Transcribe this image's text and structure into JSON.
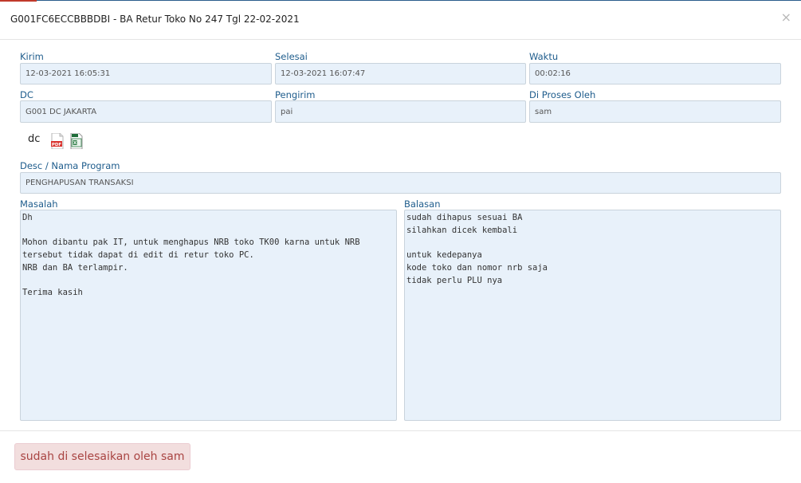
{
  "modal": {
    "title": "G001FC6ECCBBBDBI - BA Retur Toko No 247 Tgl 22-02-2021",
    "close_icon": "close-x"
  },
  "fields": {
    "kirim": {
      "label": "Kirim",
      "value": "12-03-2021 16:05:31"
    },
    "selesai": {
      "label": "Selesai",
      "value": "12-03-2021 16:07:47"
    },
    "waktu": {
      "label": "Waktu",
      "value": "00:02:16"
    },
    "dc": {
      "label": "DC",
      "value": "G001 DC JAKARTA"
    },
    "pengirim": {
      "label": "Pengirim",
      "value": "pai"
    },
    "diproses": {
      "label": "Di Proses Oleh",
      "value": "sam"
    },
    "desc": {
      "label": "Desc / Nama Program",
      "value": "PENGHAPUSAN TRANSAKSI"
    }
  },
  "attachments": {
    "prefix": "dc",
    "icons": [
      "pdf-file-icon",
      "excel-file-icon"
    ]
  },
  "masalah": {
    "label": "Masalah",
    "text": "Dh\n\nMohon dibantu pak IT, untuk menghapus NRB toko TK00 karna untuk NRB\ntersebut tidak dapat di edit di retur toko PC.\nNRB dan BA terlampir.\n\nTerima kasih"
  },
  "balasan": {
    "label": "Balasan",
    "text": "sudah dihapus sesuai BA\nsilahkan dicek kembali\n\nuntuk kedepanya\nkode toko dan nomor nrb saja\ntidak perlu PLU nya"
  },
  "footer": {
    "status_button": "sudah di selesaikan oleh sam"
  },
  "colors": {
    "label": "#1e5c8c",
    "field_bg": "#e8f1fa",
    "danger_bg": "#f2dede",
    "danger_text": "#a94442"
  }
}
